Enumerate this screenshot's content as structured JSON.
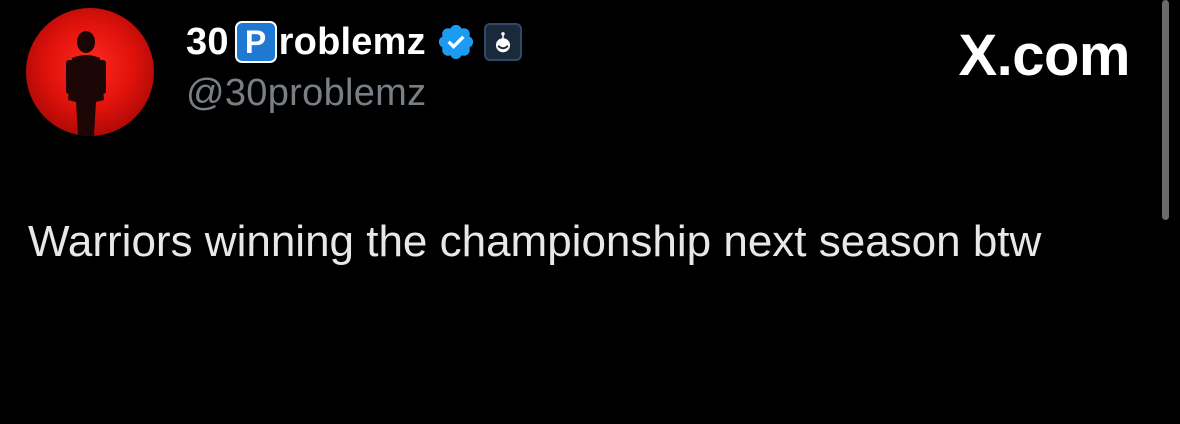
{
  "author": {
    "name_prefix": "30",
    "name_badge_letter": "P",
    "name_suffix": "roblemz",
    "handle": "@30problemz",
    "verified_icon": "verified-check-icon",
    "affiliate_icon": "affiliate-badge-icon",
    "avatar": "profile-avatar"
  },
  "brand": {
    "label": "X.com"
  },
  "tweet": {
    "text": "Warriors winning the championship next season btw"
  },
  "colors": {
    "background": "#000000",
    "verified_blue": "#1d9bf0",
    "badge_blue": "#1f78d1",
    "handle_gray": "#7a7f85",
    "avatar_red": "#e0120c"
  }
}
